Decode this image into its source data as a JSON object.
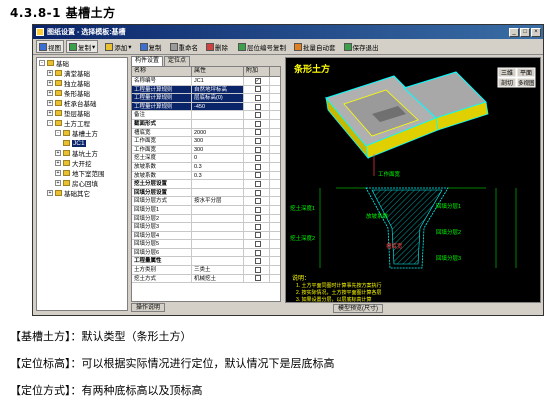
{
  "heading": "4.3.8-1 基槽土方",
  "window": {
    "title": "图纸设置 - 选择模板:基槽",
    "buttons": [
      "_",
      "□",
      "×"
    ]
  },
  "toolbar": {
    "items": [
      {
        "label": "视图",
        "icon": "blue"
      },
      {
        "label": "复制",
        "icon": "green"
      },
      {
        "label": "添加",
        "icon": "yellow"
      },
      {
        "label": "复制",
        "icon": "blue"
      },
      {
        "label": "重命名",
        "icon": "gray"
      },
      {
        "label": "删除",
        "icon": "red"
      },
      {
        "label": "层位编号复制",
        "icon": "green"
      },
      {
        "label": "批量自动套",
        "icon": "orange"
      },
      {
        "label": "保存退出",
        "icon": "green"
      }
    ]
  },
  "tree": {
    "items": [
      {
        "label": "基础",
        "level": 0,
        "expander": "-"
      },
      {
        "label": "满堂基础",
        "level": 1,
        "expander": "+"
      },
      {
        "label": "独立基础",
        "level": 1,
        "expander": "+"
      },
      {
        "label": "条形基础",
        "level": 1,
        "expander": "+"
      },
      {
        "label": "桩承台基础",
        "level": 1,
        "expander": "+"
      },
      {
        "label": "垫层基础",
        "level": 1,
        "expander": "+"
      },
      {
        "label": "土方工程",
        "level": 1,
        "expander": "-"
      },
      {
        "label": "基槽土方",
        "level": 2,
        "expander": "-"
      },
      {
        "label": "JC1",
        "level": 3,
        "expander": "",
        "selected": true
      },
      {
        "label": "基坑土方",
        "level": 2,
        "expander": "+"
      },
      {
        "label": "大开挖",
        "level": 2,
        "expander": "+"
      },
      {
        "label": "地下室范围",
        "level": 2,
        "expander": "+"
      },
      {
        "label": "房心回填",
        "level": 2,
        "expander": "+"
      },
      {
        "label": "基础其它",
        "level": 1,
        "expander": "+"
      }
    ]
  },
  "tabs": [
    "构件设置",
    "定位点"
  ],
  "props": {
    "headers": [
      "名称",
      "属性",
      "附加"
    ],
    "rows": [
      {
        "name": "名称编号",
        "value": "JC1",
        "check": "✓"
      },
      {
        "name": "工程量计算规则",
        "value": "自然地坪标高",
        "check": "",
        "hl": true
      },
      {
        "name": "工程量计算规则",
        "value": "层底标高(0)",
        "check": "",
        "hl": true
      },
      {
        "name": "工程量计算规则",
        "value": "-450",
        "check": "",
        "hl": true
      },
      {
        "name": "备注",
        "value": "",
        "check": ""
      },
      {
        "name": "截面形式",
        "value": "",
        "check": "",
        "group": true
      },
      {
        "name": "槽底宽",
        "value": "2000",
        "check": ""
      },
      {
        "name": "工作面宽",
        "value": "300",
        "check": ""
      },
      {
        "name": "工作面宽",
        "value": "300",
        "check": ""
      },
      {
        "name": "挖土深度",
        "value": "0",
        "check": ""
      },
      {
        "name": "放坡系数",
        "value": "0.3",
        "check": ""
      },
      {
        "name": "放坡系数",
        "value": "0.3",
        "check": ""
      },
      {
        "name": "挖土分层设置",
        "value": "",
        "check": "",
        "group": true
      },
      {
        "name": "回填分层设置",
        "value": "",
        "check": "",
        "group": true
      },
      {
        "name": "回填分层方式",
        "value": "按水平分层",
        "check": ""
      },
      {
        "name": "回填分层1",
        "value": "",
        "check": ""
      },
      {
        "name": "回填分层2",
        "value": "",
        "check": ""
      },
      {
        "name": "回填分层3",
        "value": "",
        "check": ""
      },
      {
        "name": "回填分层4",
        "value": "",
        "check": ""
      },
      {
        "name": "回填分层5",
        "value": "",
        "check": ""
      },
      {
        "name": "回填分层6",
        "value": "",
        "check": ""
      },
      {
        "name": "工程量属性",
        "value": "",
        "check": "",
        "group": true
      },
      {
        "name": "土方类别",
        "value": "三类土",
        "check": ""
      },
      {
        "name": "挖土方式",
        "value": "机械挖土",
        "check": ""
      }
    ]
  },
  "bottom_tab": "操作说明",
  "bottom_tab2": "模型预览(尺寸)",
  "canvas": {
    "title": "条形土方",
    "buttons": [
      "三维",
      "平面",
      "剖切",
      "多视图"
    ],
    "labels": {
      "jiaodi": "槽底宽",
      "gongzuo": "工作面宽",
      "fangpo": "放坡系数",
      "wadeep1": "挖土深度1",
      "wadeep2": "挖土深度2",
      "huitian1": "回填分层1",
      "huitian2": "回填分层2",
      "huitian3": "回填分层3"
    },
    "notes": [
      "说明：",
      "1. 土方平面同图时计算事先按方案执行",
      "2. 按实际情况，土方按平面图计算各层",
      "3. 如果设置分层，以层底标高计算"
    ]
  },
  "descriptions": [
    "【基槽土方】：默认类型（条形土方）",
    "【定位标高】：可以根据实际情况进行定位，默认情况下是层底标高",
    "【定位方式】：有两种底标高以及顶标高"
  ]
}
